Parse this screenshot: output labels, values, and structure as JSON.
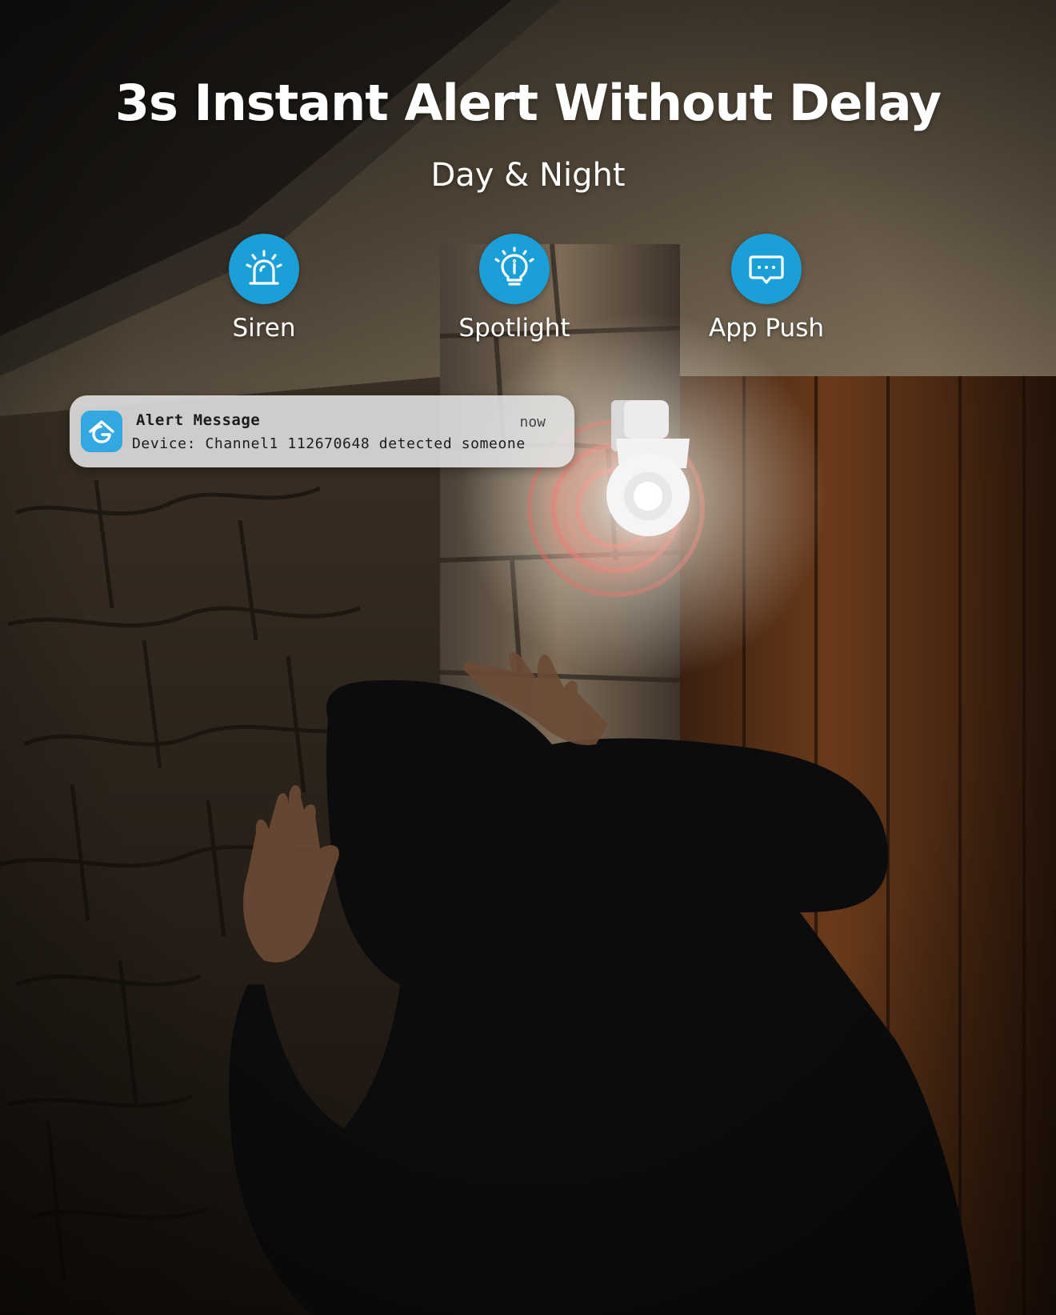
{
  "header": {
    "title": "3s Instant Alert Without Delay",
    "subtitle": "Day & Night"
  },
  "features": [
    {
      "label": "Siren",
      "icon": "siren-icon"
    },
    {
      "label": "Spotlight",
      "icon": "lightbulb-icon"
    },
    {
      "label": "App Push",
      "icon": "chat-bubble-icon"
    }
  ],
  "notification": {
    "app_icon": "app-logo-icon",
    "title": "Alert Message",
    "time": "now",
    "body": "Device: Channel1 112670648 detected someone"
  },
  "colors": {
    "accent": "#1a9fd9",
    "notification_bg": "#e4e4e4",
    "alarm_red": "#e0322c"
  }
}
